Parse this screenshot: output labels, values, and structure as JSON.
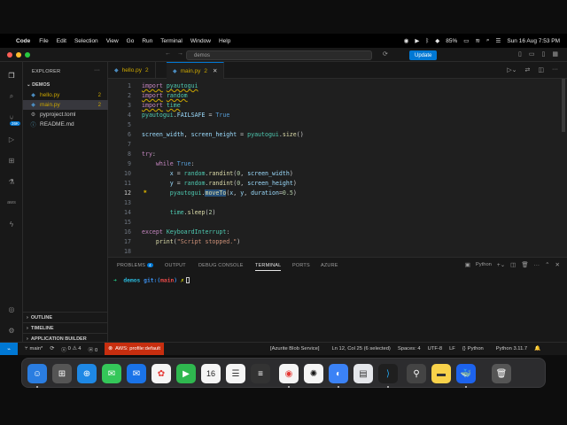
{
  "menubar": {
    "app_name": "Code",
    "items": [
      "File",
      "Edit",
      "Selection",
      "View",
      "Go",
      "Run",
      "Terminal",
      "Window",
      "Help"
    ],
    "battery": "85%",
    "datetime": "Sun 16 Aug  7:53 PM"
  },
  "titlebar": {
    "search_text": "demos",
    "update_label": "Update"
  },
  "activity_bar": {
    "icons": [
      "files-icon",
      "search-icon",
      "source-control-icon",
      "run-debug-icon",
      "extensions-icon",
      "testing-icon",
      "aws-icon",
      "remote-icon",
      "account-icon",
      "settings-gear-icon"
    ],
    "source_control_badge": "26K",
    "aws_label": "aws"
  },
  "sidebar": {
    "title": "EXPLORER",
    "folder": "DEMOS",
    "files": [
      {
        "name": "hello.py",
        "count": "2",
        "icon": "python-file-icon"
      },
      {
        "name": "main.py",
        "count": "2",
        "icon": "python-file-icon"
      },
      {
        "name": "pyproject.toml",
        "count": "",
        "icon": "settings-file-icon"
      },
      {
        "name": "README.md",
        "count": "",
        "icon": "markdown-file-icon"
      }
    ],
    "sections": [
      "OUTLINE",
      "TIMELINE",
      "APPLICATION BUILDER"
    ]
  },
  "tabs": [
    {
      "name": "hello.py",
      "count": "2"
    },
    {
      "name": "main.py",
      "count": "2"
    }
  ],
  "editor": {
    "line_numbers": [
      "1",
      "2",
      "3",
      "4",
      "5",
      "6",
      "7",
      "8",
      "9",
      "10",
      "11",
      "12",
      "13",
      "14",
      "15",
      "16",
      "17",
      "18"
    ],
    "current_line": "12",
    "tokens": {
      "import": "import",
      "pyautogui": "pyautogui",
      "random": "random",
      "time": "time",
      "failsafe": "FAILSAFE",
      "eq": " = ",
      "true": "True",
      "screen_width": "screen_width",
      "comma": ", ",
      "screen_height": "screen_height",
      "size": "size",
      "try": "try",
      "while": "while",
      "x": "x",
      "y": "y",
      "randint": "randint",
      "zero": "0",
      "moveto": "moveTo",
      "duration": "duration",
      "half": "0.5",
      "sleep": "sleep",
      "two": "2",
      "except": "except",
      "kbi": "KeyboardInterrupt",
      "print": "print",
      "msg": "\"Script stopped.\""
    }
  },
  "panel": {
    "tabs": [
      "PROBLEMS",
      "OUTPUT",
      "DEBUG CONSOLE",
      "TERMINAL",
      "PORTS",
      "AZURE"
    ],
    "problems_count": "4",
    "terminal_profile": "Python",
    "prompt_arrow": "➜",
    "prompt_dir": "demos",
    "prompt_git": "git:(",
    "prompt_branch": "main",
    "prompt_git_close": ")",
    "prompt_x": "✗"
  },
  "statusbar": {
    "branch": "main*",
    "errors": "0",
    "warnings": "4",
    "aws_profile": "AWS: profile:default",
    "azurite_blob": "[Azurite Blob Service]",
    "position": "Ln 12, Col 25 (6 selected)",
    "spaces": "Spaces: 4",
    "encoding": "UTF-8",
    "eol": "LF",
    "language": "Python",
    "interpreter": "Python 3.11.7"
  },
  "dock": {
    "apps": [
      "Finder",
      "Launchpad",
      "Safari",
      "Messages",
      "Mail",
      "Photos",
      "FaceTime",
      "Calendar",
      "Reminders",
      "Notes",
      "Chrome",
      "ChatGPT",
      "Proxyman",
      "Preview",
      "Visual Studio Code",
      "Script Editor",
      "Notes Yellow",
      "Docker",
      "Trash"
    ],
    "calendar_day": "16"
  },
  "colors": {
    "accent": "#0078d4",
    "warning": "#cca700",
    "aws_red": "#c72e0f"
  }
}
